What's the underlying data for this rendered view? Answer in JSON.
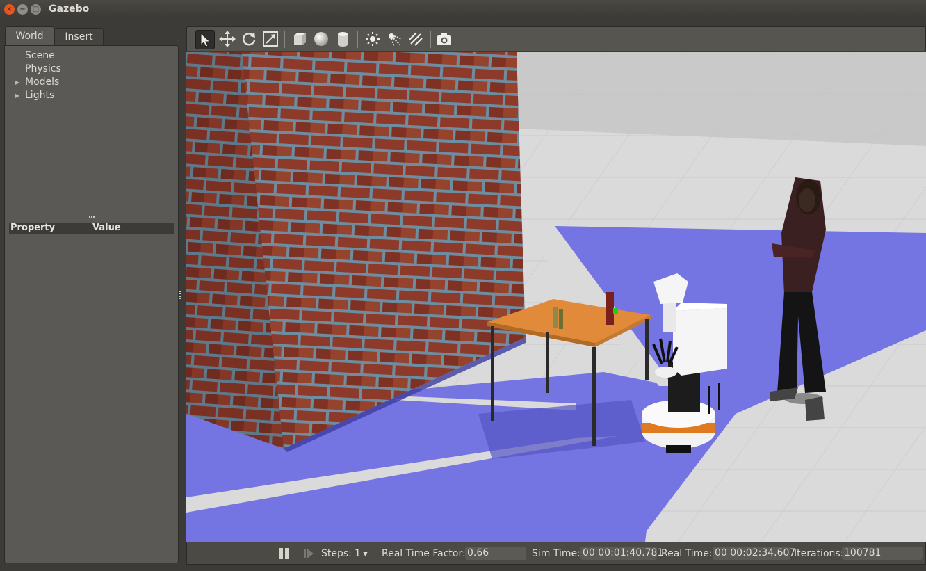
{
  "window": {
    "title": "Gazebo",
    "close_glyph": "×",
    "min_glyph": "−",
    "max_glyph": "□"
  },
  "left_panel": {
    "tabs": [
      {
        "label": "World",
        "active": true
      },
      {
        "label": "Insert",
        "active": false
      }
    ],
    "tree": [
      {
        "label": "Scene",
        "expandable": false
      },
      {
        "label": "Physics",
        "expandable": false
      },
      {
        "label": "Models",
        "expandable": true
      },
      {
        "label": "Lights",
        "expandable": true
      }
    ],
    "property_header": {
      "property": "Property",
      "value": "Value"
    }
  },
  "toolbar": {
    "tools": [
      {
        "name": "select-tool-icon",
        "active": true
      },
      {
        "name": "translate-tool-icon"
      },
      {
        "name": "rotate-tool-icon"
      },
      {
        "name": "scale-tool-icon"
      },
      {
        "name": "box-shape-icon"
      },
      {
        "name": "sphere-shape-icon"
      },
      {
        "name": "cylinder-shape-icon"
      },
      {
        "name": "point-light-icon"
      },
      {
        "name": "spot-light-icon"
      },
      {
        "name": "directional-light-icon"
      },
      {
        "name": "screenshot-camera-icon"
      }
    ]
  },
  "bottom_bar": {
    "steps_label": "Steps:",
    "steps_value": "1",
    "rtf_label": "Real Time Factor:",
    "rtf_value": "0.66",
    "sim_time_label": "Sim Time:",
    "sim_time_value": "00 00:01:40.781",
    "real_time_label": "Real Time:",
    "real_time_value": "00 00:02:34.607",
    "iterations_label": "Iterations:",
    "iterations_value": "100781"
  },
  "colors": {
    "laser": "#7474e2",
    "ground": "#dadada",
    "brick": "#8e3a2a",
    "table_top": "#e08a3a",
    "accent": "#e95420"
  }
}
